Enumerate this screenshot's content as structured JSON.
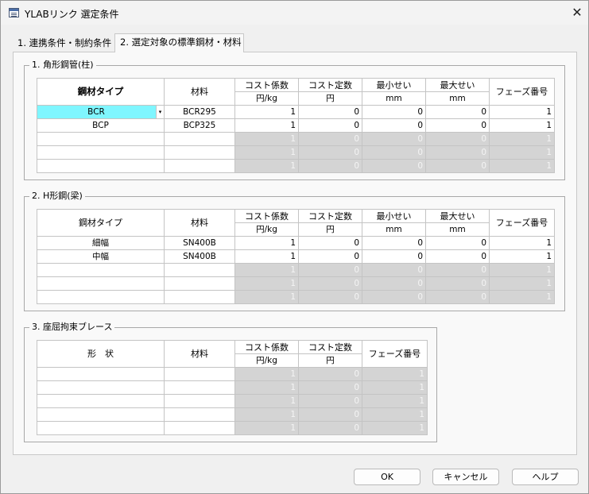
{
  "window": {
    "title": "YLABリンク 選定条件",
    "close_glyph": "✕",
    "icon": "form-window-icon"
  },
  "tabs": [
    {
      "label": "1. 連携条件・制約条件"
    },
    {
      "label": "2. 選定対象の標準鋼材・材料"
    }
  ],
  "group1": {
    "title": "1. 角形鋼管(柱)",
    "headers": {
      "type": "鋼材タイプ",
      "material": "材料",
      "cost_coef": "コスト係数",
      "cost_coef_unit": "円/kg",
      "cost_const": "コスト定数",
      "cost_const_unit": "円",
      "min_h": "最小せい",
      "min_h_unit": "mm",
      "max_h": "最大せい",
      "max_h_unit": "mm",
      "phase": "フェーズ番号"
    },
    "dropdown_glyph": "▾",
    "rows": [
      {
        "type": "BCR",
        "material": "BCR295",
        "coef": "1",
        "const": "0",
        "min": "0",
        "max": "0",
        "phase": "1"
      },
      {
        "type": "BCP",
        "material": "BCP325",
        "coef": "1",
        "const": "0",
        "min": "0",
        "max": "0",
        "phase": "1"
      },
      {
        "type": "",
        "material": "",
        "coef": "1",
        "const": "0",
        "min": "0",
        "max": "0",
        "phase": "1"
      },
      {
        "type": "",
        "material": "",
        "coef": "1",
        "const": "0",
        "min": "0",
        "max": "0",
        "phase": "1"
      },
      {
        "type": "",
        "material": "",
        "coef": "1",
        "const": "0",
        "min": "0",
        "max": "0",
        "phase": "1"
      }
    ]
  },
  "group2": {
    "title": "2. H形鋼(梁)",
    "headers": {
      "type": "鋼材タイプ",
      "material": "材料",
      "cost_coef": "コスト係数",
      "cost_coef_unit": "円/kg",
      "cost_const": "コスト定数",
      "cost_const_unit": "円",
      "min_h": "最小せい",
      "min_h_unit": "mm",
      "max_h": "最大せい",
      "max_h_unit": "mm",
      "phase": "フェーズ番号"
    },
    "rows": [
      {
        "type": "細幅",
        "material": "SN400B",
        "coef": "1",
        "const": "0",
        "min": "0",
        "max": "0",
        "phase": "1"
      },
      {
        "type": "中幅",
        "material": "SN400B",
        "coef": "1",
        "const": "0",
        "min": "0",
        "max": "0",
        "phase": "1"
      },
      {
        "type": "",
        "material": "",
        "coef": "1",
        "const": "0",
        "min": "0",
        "max": "0",
        "phase": "1"
      },
      {
        "type": "",
        "material": "",
        "coef": "1",
        "const": "0",
        "min": "0",
        "max": "0",
        "phase": "1"
      },
      {
        "type": "",
        "material": "",
        "coef": "1",
        "const": "0",
        "min": "0",
        "max": "0",
        "phase": "1"
      }
    ]
  },
  "group3": {
    "title": "3. 座屈拘束ブレース",
    "headers": {
      "shape": "形　状",
      "material": "材料",
      "cost_coef": "コスト係数",
      "cost_coef_unit": "円/kg",
      "cost_const": "コスト定数",
      "cost_const_unit": "円",
      "phase": "フェーズ番号"
    },
    "rows": [
      {
        "shape": "",
        "material": "",
        "coef": "1",
        "const": "0",
        "phase": "1"
      },
      {
        "shape": "",
        "material": "",
        "coef": "1",
        "const": "0",
        "phase": "1"
      },
      {
        "shape": "",
        "material": "",
        "coef": "1",
        "const": "0",
        "phase": "1"
      },
      {
        "shape": "",
        "material": "",
        "coef": "1",
        "const": "0",
        "phase": "1"
      },
      {
        "shape": "",
        "material": "",
        "coef": "1",
        "const": "0",
        "phase": "1"
      }
    ]
  },
  "buttons": {
    "ok": "OK",
    "cancel": "キャンセル",
    "help": "ヘルプ"
  },
  "colors": {
    "selected_cell": "#7ff6ff",
    "disabled_cell": "#d4d4d4"
  }
}
